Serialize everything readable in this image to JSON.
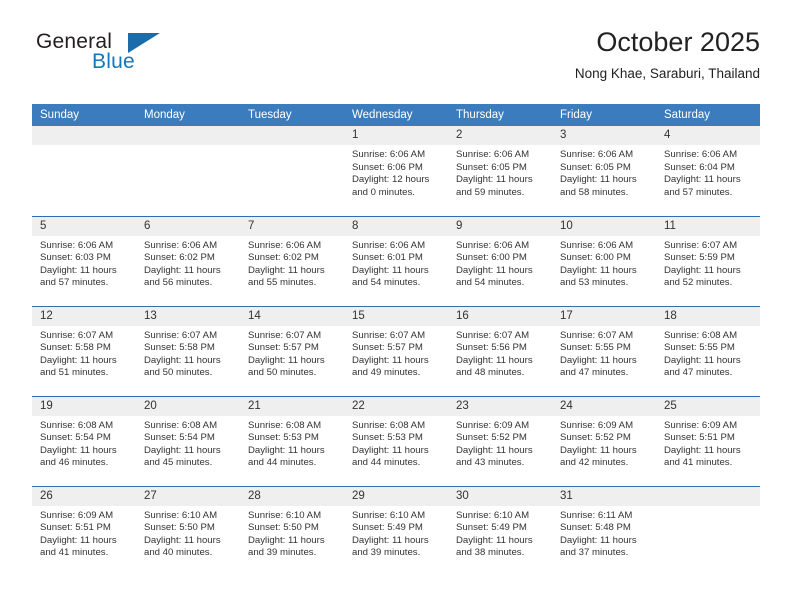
{
  "brand": {
    "name_part1": "General",
    "name_part2": "Blue",
    "triangle_color": "#1b6ca8",
    "blue_text_color": "#1277bc"
  },
  "header": {
    "title": "October 2025",
    "subtitle": "Nong Khae, Saraburi, Thailand"
  },
  "theme": {
    "header_row_bg": "#3b7cbf",
    "row_divider": "#2f6fb0",
    "daynum_band_bg": "#efefef",
    "text_color": "#333333"
  },
  "weekdays": [
    "Sunday",
    "Monday",
    "Tuesday",
    "Wednesday",
    "Thursday",
    "Friday",
    "Saturday"
  ],
  "weeks": [
    [
      {
        "day": "",
        "sunrise": "",
        "sunset": "",
        "daylight1": "",
        "daylight2": ""
      },
      {
        "day": "",
        "sunrise": "",
        "sunset": "",
        "daylight1": "",
        "daylight2": ""
      },
      {
        "day": "",
        "sunrise": "",
        "sunset": "",
        "daylight1": "",
        "daylight2": ""
      },
      {
        "day": "1",
        "sunrise": "Sunrise: 6:06 AM",
        "sunset": "Sunset: 6:06 PM",
        "daylight1": "Daylight: 12 hours",
        "daylight2": "and 0 minutes."
      },
      {
        "day": "2",
        "sunrise": "Sunrise: 6:06 AM",
        "sunset": "Sunset: 6:05 PM",
        "daylight1": "Daylight: 11 hours",
        "daylight2": "and 59 minutes."
      },
      {
        "day": "3",
        "sunrise": "Sunrise: 6:06 AM",
        "sunset": "Sunset: 6:05 PM",
        "daylight1": "Daylight: 11 hours",
        "daylight2": "and 58 minutes."
      },
      {
        "day": "4",
        "sunrise": "Sunrise: 6:06 AM",
        "sunset": "Sunset: 6:04 PM",
        "daylight1": "Daylight: 11 hours",
        "daylight2": "and 57 minutes."
      }
    ],
    [
      {
        "day": "5",
        "sunrise": "Sunrise: 6:06 AM",
        "sunset": "Sunset: 6:03 PM",
        "daylight1": "Daylight: 11 hours",
        "daylight2": "and 57 minutes."
      },
      {
        "day": "6",
        "sunrise": "Sunrise: 6:06 AM",
        "sunset": "Sunset: 6:02 PM",
        "daylight1": "Daylight: 11 hours",
        "daylight2": "and 56 minutes."
      },
      {
        "day": "7",
        "sunrise": "Sunrise: 6:06 AM",
        "sunset": "Sunset: 6:02 PM",
        "daylight1": "Daylight: 11 hours",
        "daylight2": "and 55 minutes."
      },
      {
        "day": "8",
        "sunrise": "Sunrise: 6:06 AM",
        "sunset": "Sunset: 6:01 PM",
        "daylight1": "Daylight: 11 hours",
        "daylight2": "and 54 minutes."
      },
      {
        "day": "9",
        "sunrise": "Sunrise: 6:06 AM",
        "sunset": "Sunset: 6:00 PM",
        "daylight1": "Daylight: 11 hours",
        "daylight2": "and 54 minutes."
      },
      {
        "day": "10",
        "sunrise": "Sunrise: 6:06 AM",
        "sunset": "Sunset: 6:00 PM",
        "daylight1": "Daylight: 11 hours",
        "daylight2": "and 53 minutes."
      },
      {
        "day": "11",
        "sunrise": "Sunrise: 6:07 AM",
        "sunset": "Sunset: 5:59 PM",
        "daylight1": "Daylight: 11 hours",
        "daylight2": "and 52 minutes."
      }
    ],
    [
      {
        "day": "12",
        "sunrise": "Sunrise: 6:07 AM",
        "sunset": "Sunset: 5:58 PM",
        "daylight1": "Daylight: 11 hours",
        "daylight2": "and 51 minutes."
      },
      {
        "day": "13",
        "sunrise": "Sunrise: 6:07 AM",
        "sunset": "Sunset: 5:58 PM",
        "daylight1": "Daylight: 11 hours",
        "daylight2": "and 50 minutes."
      },
      {
        "day": "14",
        "sunrise": "Sunrise: 6:07 AM",
        "sunset": "Sunset: 5:57 PM",
        "daylight1": "Daylight: 11 hours",
        "daylight2": "and 50 minutes."
      },
      {
        "day": "15",
        "sunrise": "Sunrise: 6:07 AM",
        "sunset": "Sunset: 5:57 PM",
        "daylight1": "Daylight: 11 hours",
        "daylight2": "and 49 minutes."
      },
      {
        "day": "16",
        "sunrise": "Sunrise: 6:07 AM",
        "sunset": "Sunset: 5:56 PM",
        "daylight1": "Daylight: 11 hours",
        "daylight2": "and 48 minutes."
      },
      {
        "day": "17",
        "sunrise": "Sunrise: 6:07 AM",
        "sunset": "Sunset: 5:55 PM",
        "daylight1": "Daylight: 11 hours",
        "daylight2": "and 47 minutes."
      },
      {
        "day": "18",
        "sunrise": "Sunrise: 6:08 AM",
        "sunset": "Sunset: 5:55 PM",
        "daylight1": "Daylight: 11 hours",
        "daylight2": "and 47 minutes."
      }
    ],
    [
      {
        "day": "19",
        "sunrise": "Sunrise: 6:08 AM",
        "sunset": "Sunset: 5:54 PM",
        "daylight1": "Daylight: 11 hours",
        "daylight2": "and 46 minutes."
      },
      {
        "day": "20",
        "sunrise": "Sunrise: 6:08 AM",
        "sunset": "Sunset: 5:54 PM",
        "daylight1": "Daylight: 11 hours",
        "daylight2": "and 45 minutes."
      },
      {
        "day": "21",
        "sunrise": "Sunrise: 6:08 AM",
        "sunset": "Sunset: 5:53 PM",
        "daylight1": "Daylight: 11 hours",
        "daylight2": "and 44 minutes."
      },
      {
        "day": "22",
        "sunrise": "Sunrise: 6:08 AM",
        "sunset": "Sunset: 5:53 PM",
        "daylight1": "Daylight: 11 hours",
        "daylight2": "and 44 minutes."
      },
      {
        "day": "23",
        "sunrise": "Sunrise: 6:09 AM",
        "sunset": "Sunset: 5:52 PM",
        "daylight1": "Daylight: 11 hours",
        "daylight2": "and 43 minutes."
      },
      {
        "day": "24",
        "sunrise": "Sunrise: 6:09 AM",
        "sunset": "Sunset: 5:52 PM",
        "daylight1": "Daylight: 11 hours",
        "daylight2": "and 42 minutes."
      },
      {
        "day": "25",
        "sunrise": "Sunrise: 6:09 AM",
        "sunset": "Sunset: 5:51 PM",
        "daylight1": "Daylight: 11 hours",
        "daylight2": "and 41 minutes."
      }
    ],
    [
      {
        "day": "26",
        "sunrise": "Sunrise: 6:09 AM",
        "sunset": "Sunset: 5:51 PM",
        "daylight1": "Daylight: 11 hours",
        "daylight2": "and 41 minutes."
      },
      {
        "day": "27",
        "sunrise": "Sunrise: 6:10 AM",
        "sunset": "Sunset: 5:50 PM",
        "daylight1": "Daylight: 11 hours",
        "daylight2": "and 40 minutes."
      },
      {
        "day": "28",
        "sunrise": "Sunrise: 6:10 AM",
        "sunset": "Sunset: 5:50 PM",
        "daylight1": "Daylight: 11 hours",
        "daylight2": "and 39 minutes."
      },
      {
        "day": "29",
        "sunrise": "Sunrise: 6:10 AM",
        "sunset": "Sunset: 5:49 PM",
        "daylight1": "Daylight: 11 hours",
        "daylight2": "and 39 minutes."
      },
      {
        "day": "30",
        "sunrise": "Sunrise: 6:10 AM",
        "sunset": "Sunset: 5:49 PM",
        "daylight1": "Daylight: 11 hours",
        "daylight2": "and 38 minutes."
      },
      {
        "day": "31",
        "sunrise": "Sunrise: 6:11 AM",
        "sunset": "Sunset: 5:48 PM",
        "daylight1": "Daylight: 11 hours",
        "daylight2": "and 37 minutes."
      },
      {
        "day": "",
        "sunrise": "",
        "sunset": "",
        "daylight1": "",
        "daylight2": ""
      }
    ]
  ]
}
